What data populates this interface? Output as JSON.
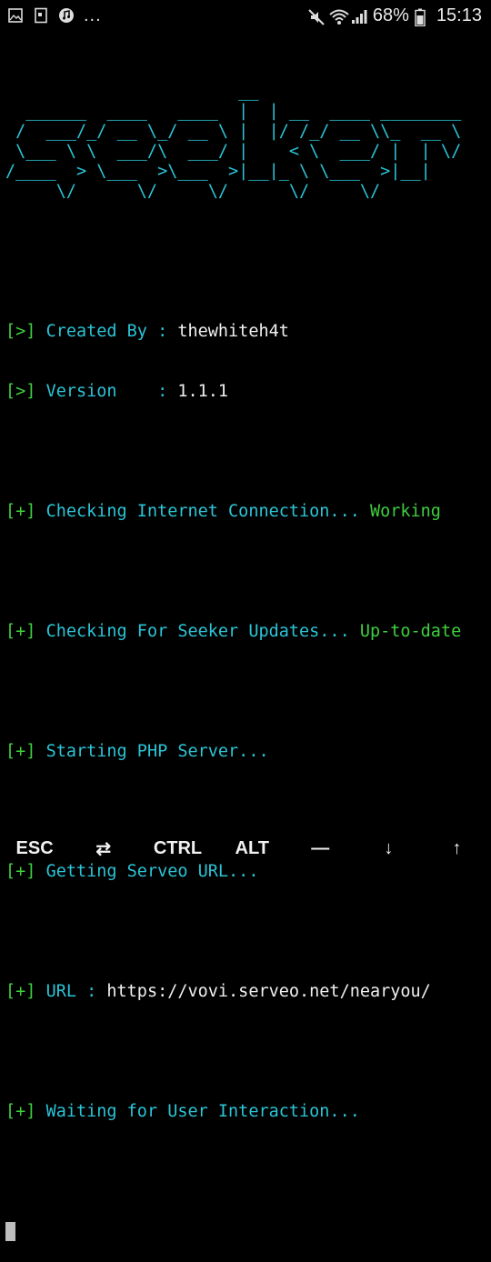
{
  "status_bar": {
    "battery_percent": "68%",
    "time": "15:13",
    "more": "..."
  },
  "terminal": {
    "banner": "                       __\n  ______  ____   ____  |  | __  ____ ________\n /  ___/_/ __ \\_/ __ \\ |  |/ /_/ __ \\\\_  __ \\\n \\___ \\ \\  ___/\\  ___/ |    < \\  ___/ |  | \\/\n/____  > \\___  >\\___  >|__|_ \\ \\___  >|__|\n     \\/      \\/     \\/      \\/     \\/",
    "lines": [
      {
        "prefix": "[>] ",
        "label": "Created By : ",
        "value": "thewhiteh4t"
      },
      {
        "prefix": "[>] ",
        "label": "Version    : ",
        "value": "1.1.1"
      },
      {
        "prefix": "[+] ",
        "label": "Checking Internet Connection... ",
        "value": "Working"
      },
      {
        "prefix": "[+] ",
        "label": "Checking For Seeker Updates... ",
        "value": "Up-to-date"
      },
      {
        "prefix": "[+] ",
        "label": "Starting PHP Server...",
        "value": ""
      },
      {
        "prefix": "[+] ",
        "label": "Getting Serveo URL...",
        "value": ""
      },
      {
        "prefix": "[+] ",
        "label": "URL : ",
        "value": "https://vovi.serveo.net/nearyou/"
      },
      {
        "prefix": "[+] ",
        "label": "Waiting for User Interaction...",
        "value": ""
      }
    ]
  },
  "extra_keys": {
    "esc": "ESC",
    "tab": "⇄",
    "ctrl": "CTRL",
    "alt": "ALT",
    "dash": "—",
    "down": "↓",
    "up": "↑"
  },
  "colors": {
    "prefix_green": "#3fcf3f",
    "text_cyan": "#2bc4d6",
    "value_white": "#f0f0f0",
    "background": "#000000"
  },
  "icons": [
    "gallery-icon",
    "sim-card-icon",
    "music-icon",
    "mute-icon",
    "wifi-icon",
    "signal-icon",
    "battery-icon"
  ]
}
